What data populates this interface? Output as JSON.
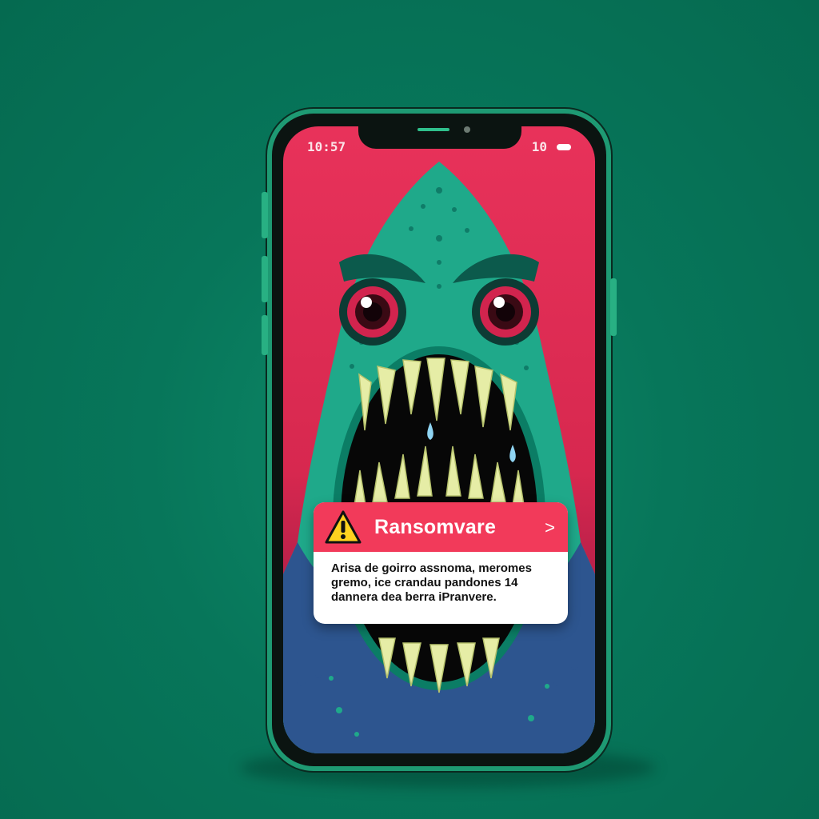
{
  "status_bar": {
    "time": "10:57",
    "right_text": "10",
    "battery_icon": "battery-icon"
  },
  "notification": {
    "icon": "warning-icon",
    "title": "Ransomvare",
    "chevron_icon": "chevron-right-icon",
    "body_lines": [
      "Arisa de goirro assnoma, meromes",
      "gremo, ice crandau pandones 14",
      "dannera dea berra iPranvere."
    ]
  },
  "colors": {
    "background": "#07765a",
    "screen_red": "#e8325a",
    "monster_teal": "#1fa98a",
    "monster_blue": "#2d558f",
    "alert_header": "#f23a5a",
    "warning_yellow": "#ffd21f"
  }
}
